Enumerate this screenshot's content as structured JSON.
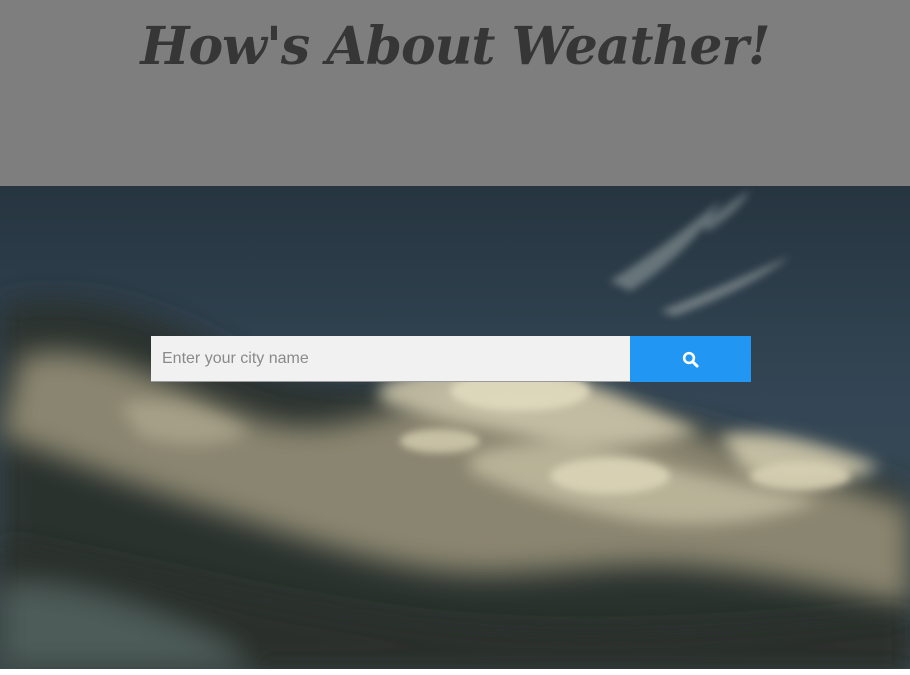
{
  "header": {
    "title": "How's About Weather!"
  },
  "search": {
    "placeholder": "Enter your city name",
    "value": "",
    "button_icon": "search-icon"
  },
  "colors": {
    "header_background": "#7e7e7e",
    "title_text": "#363636",
    "search_button": "#2196f3",
    "search_input_background": "#f1f1f1"
  }
}
